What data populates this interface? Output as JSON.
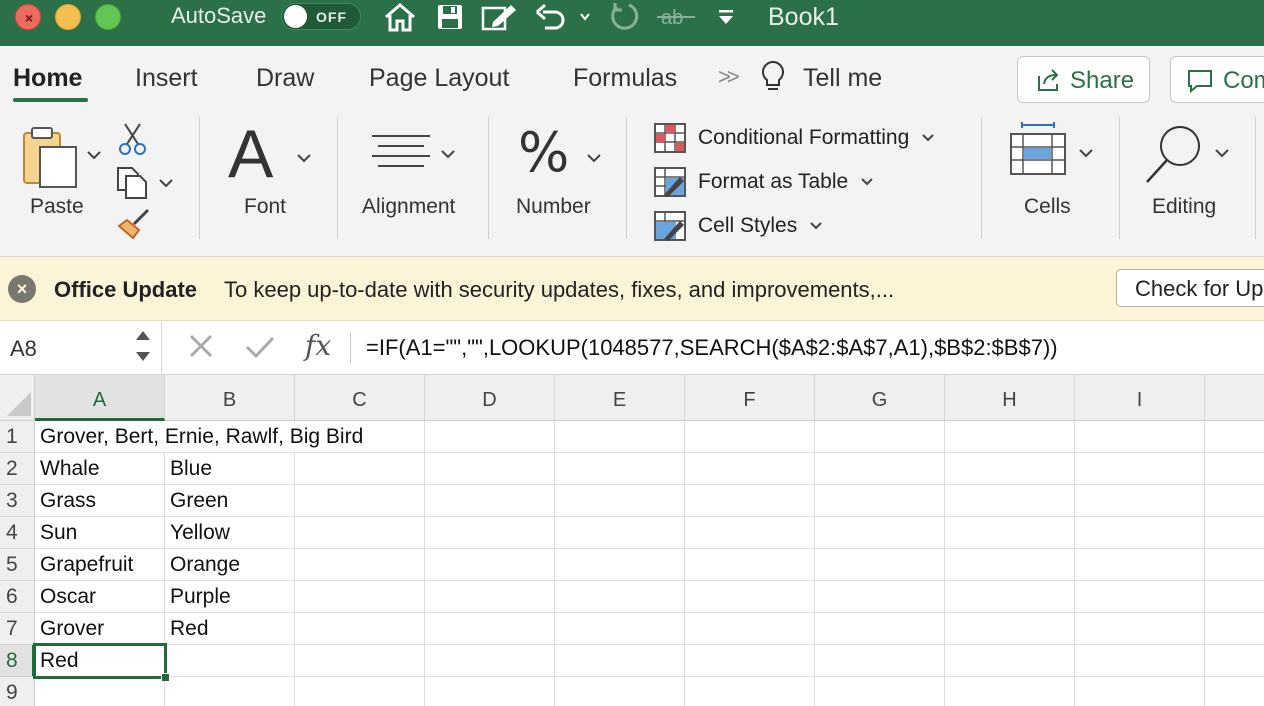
{
  "titlebar": {
    "autosave_label": "AutoSave",
    "autosave_state": "OFF",
    "document_title": "Book1",
    "quick_access_icons": [
      "home-icon",
      "save-icon",
      "edit-icon",
      "undo-icon",
      "redo-icon",
      "strikethrough-icon",
      "customize-toolbar-icon"
    ]
  },
  "tabs": {
    "home": "Home",
    "insert": "Insert",
    "draw": "Draw",
    "page_layout": "Page Layout",
    "formulas": "Formulas",
    "more": "»",
    "tell_me": "Tell me",
    "share": "Share",
    "comments": "Comments"
  },
  "ribbon": {
    "paste": "Paste",
    "font": "Font",
    "font_glyph": "A",
    "alignment": "Alignment",
    "number": "Number",
    "number_glyph": "%",
    "conditional_formatting": "Conditional Formatting",
    "format_as_table": "Format as Table",
    "cell_styles": "Cell Styles",
    "cells": "Cells",
    "editing": "Editing"
  },
  "message_bar": {
    "title": "Office Update",
    "text": "To keep up-to-date with security updates, fixes, and improvements,...",
    "button": "Check for Updates",
    "background": "#fcf4d6"
  },
  "formula_bar": {
    "name_box": "A8",
    "fx": "fx",
    "formula": "=IF(A1=\"\",\"\",LOOKUP(1048577,SEARCH($A$2:$A$7,A1),$B$2:$B$7))"
  },
  "grid": {
    "columns": [
      "A",
      "B",
      "C",
      "D",
      "E",
      "F",
      "G",
      "H",
      "I"
    ],
    "rows": [
      "1",
      "2",
      "3",
      "4",
      "5",
      "6",
      "7",
      "8",
      "9"
    ],
    "selected_cell": "A8",
    "cells": {
      "A1": "Grover, Bert, Ernie, Rawlf, Big Bird",
      "A2": "Whale",
      "B2": "Blue",
      "A3": "Grass",
      "B3": "Green",
      "A4": "Sun",
      "B4": "Yellow",
      "A5": "Grapefruit",
      "B5": "Orange",
      "A6": "Oscar",
      "B6": "Purple",
      "A7": "Grover",
      "B7": "Red",
      "A8": "Red"
    }
  },
  "colors": {
    "title_bar": "#2b7046",
    "accent": "#1f6b3b"
  }
}
